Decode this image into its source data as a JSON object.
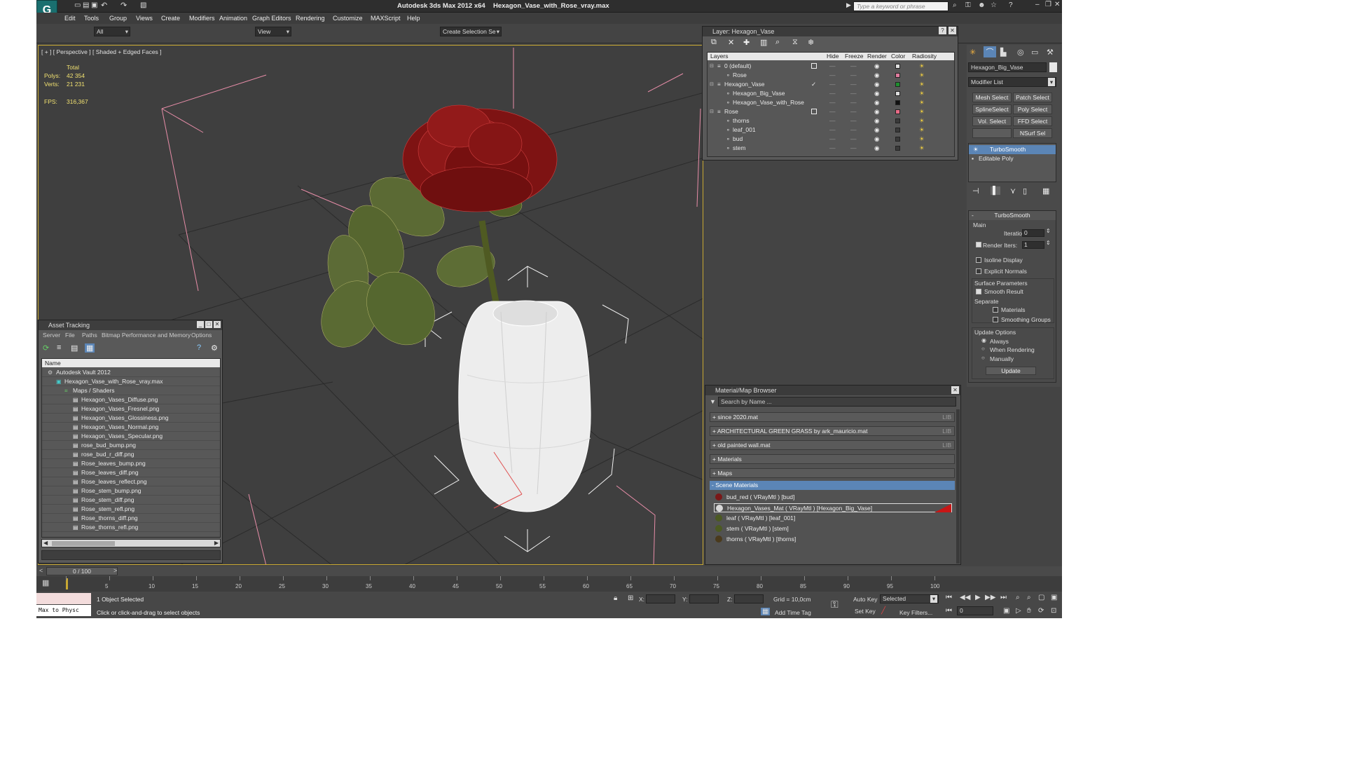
{
  "app": {
    "title_app": "Autodesk 3ds Max 2012 x64",
    "title_file": "Hexagon_Vase_with_Rose_vray.max",
    "search_placeholder": "Type a keyword or phrase"
  },
  "menu": [
    "Edit",
    "Tools",
    "Group",
    "Views",
    "Create",
    "Modifiers",
    "Animation",
    "Graph Editors",
    "Rendering",
    "Customize",
    "MAXScript",
    "Help"
  ],
  "toolbar": {
    "filter_value": "All",
    "view_value": "View",
    "selection_set_value": "Create Selection Se"
  },
  "viewport": {
    "label": "[ + ] [ Perspective ] [ Shaded + Edged Faces ]",
    "stats": {
      "total_label": "Total",
      "polys_label": "Polys:",
      "polys_value": "42 354",
      "verts_label": "Verts:",
      "verts_value": "21 231",
      "fps_label": "FPS:",
      "fps_value": "316,367"
    }
  },
  "layer_panel": {
    "title": "Layer: Hexagon_Vase",
    "columns": [
      "Layers",
      "Hide",
      "Freeze",
      "Render",
      "Color",
      "Radiosity"
    ],
    "rows": [
      {
        "name": "0 (default)",
        "level": 0,
        "color": "#e0e0e0",
        "mark": "square"
      },
      {
        "name": "Rose",
        "level": 1,
        "color": "#e07c9e",
        "mark": ""
      },
      {
        "name": "Hexagon_Vase",
        "level": 0,
        "color": "#1e8f2e",
        "mark": "check"
      },
      {
        "name": "Hexagon_Big_Vase",
        "level": 1,
        "color": "#dedede",
        "mark": ""
      },
      {
        "name": "Hexagon_Vase_with_Rose",
        "level": 1,
        "color": "#111111",
        "mark": ""
      },
      {
        "name": "Rose",
        "level": 0,
        "color": "#e86a86",
        "mark": "square"
      },
      {
        "name": "thorns",
        "level": 1,
        "color": "#3a3a3a",
        "mark": ""
      },
      {
        "name": "leaf_001",
        "level": 1,
        "color": "#3a3a3a",
        "mark": ""
      },
      {
        "name": "bud",
        "level": 1,
        "color": "#3a3a3a",
        "mark": ""
      },
      {
        "name": "stem",
        "level": 1,
        "color": "#3a3a3a",
        "mark": ""
      }
    ]
  },
  "asset_panel": {
    "title": "Asset Tracking",
    "menu": [
      "Server",
      "File",
      "Paths",
      "Bitmap Performance and Memory",
      "Options"
    ],
    "column": "Name",
    "rows": [
      {
        "name": "Autodesk Vault 2012",
        "level": 0
      },
      {
        "name": "Hexagon_Vase_with_Rose_vray.max",
        "level": 1
      },
      {
        "name": "Maps / Shaders",
        "level": 2
      },
      {
        "name": "Hexagon_Vases_Diffuse.png",
        "level": 3
      },
      {
        "name": "Hexagon_Vases_Fresnel.png",
        "level": 3
      },
      {
        "name": "Hexagon_Vases_Glossiness.png",
        "level": 3
      },
      {
        "name": "Hexagon_Vases_Normal.png",
        "level": 3
      },
      {
        "name": "Hexagon_Vases_Specular.png",
        "level": 3
      },
      {
        "name": "rose_bud_bump.png",
        "level": 3
      },
      {
        "name": "rose_bud_r_diff.png",
        "level": 3
      },
      {
        "name": "Rose_leaves_bump.png",
        "level": 3
      },
      {
        "name": "Rose_leaves_diff.png",
        "level": 3
      },
      {
        "name": "Rose_leaves_reflect.png",
        "level": 3
      },
      {
        "name": "Rose_stem_bump.png",
        "level": 3
      },
      {
        "name": "Rose_stem_diff.png",
        "level": 3
      },
      {
        "name": "Rose_stem_refl.png",
        "level": 3
      },
      {
        "name": "Rose_thorns_diff.png",
        "level": 3
      },
      {
        "name": "Rose_thorns_refl.png",
        "level": 3
      }
    ]
  },
  "material_browser": {
    "title": "Material/Map Browser",
    "search_placeholder": "Search by Name ...",
    "groups": [
      {
        "label": "+ since 2020.mat",
        "tag": "LIB"
      },
      {
        "label": "+ ARCHITECTURAL GREEN GRASS by ark_mauricio.mat",
        "tag": "LIB"
      },
      {
        "label": "+ old painted wall.mat",
        "tag": "LIB"
      },
      {
        "label": "+ Materials",
        "tag": ""
      },
      {
        "label": "+ Maps",
        "tag": ""
      }
    ],
    "scene_header": "- Scene Materials",
    "scene_materials": [
      {
        "label": "bud_red  ( VRayMtl ) [bud]",
        "swatch": "#7a1818"
      },
      {
        "label": "Hexagon_Vases_Mat  ( VRayMtl ) [Hexagon_Big_Vase]",
        "swatch": "#d8d8d8"
      },
      {
        "label": "leaf  ( VRayMtl ) [leaf_001]",
        "swatch": "#4c5a22"
      },
      {
        "label": "stem  ( VRayMtl ) [stem]",
        "swatch": "#4c5a22"
      },
      {
        "label": "thorns  ( VRayMtl ) [thorns]",
        "swatch": "#4a3a1c"
      }
    ]
  },
  "command_panel": {
    "object_name": "Hexagon_Big_Vase",
    "modifier_list": "Modifier List",
    "mod_buttons": [
      "Mesh Select",
      "Patch Select",
      "SplineSelect",
      "Poly Select",
      "Vol. Select",
      "FFD Select",
      "",
      "NSurf Sel"
    ],
    "stack": [
      "TurboSmooth",
      "Editable Poly"
    ],
    "rollout_title": "TurboSmooth",
    "main_label": "Main",
    "iterations_label": "Iterations:",
    "iterations_value": "0",
    "render_iters_label": "Render Iters:",
    "render_iters_value": "1",
    "isoline": "Isoline Display",
    "explicit": "Explicit Normals",
    "surface_params": "Surface Parameters",
    "smooth_result": "Smooth Result",
    "separate": "Separate",
    "materials": "Materials",
    "smoothing_groups": "Smoothing Groups",
    "update_options": "Update Options",
    "always": "Always",
    "when_rendering": "When Rendering",
    "manually": "Manually",
    "update": "Update"
  },
  "timeline": {
    "frame_display": "0 / 100",
    "ticks": [
      "0",
      "5",
      "10",
      "15",
      "20",
      "25",
      "30",
      "35",
      "40",
      "45",
      "50",
      "55",
      "60",
      "65",
      "70",
      "75",
      "80",
      "85",
      "90",
      "95",
      "100"
    ]
  },
  "status": {
    "maxscript": "Max to Physc",
    "selected": "1 Object Selected",
    "prompt": "Click or click-and-drag to select objects",
    "x_label": "X:",
    "y_label": "Y:",
    "z_label": "Z:",
    "grid": "Grid = 10,0cm",
    "add_time_tag": "Add Time Tag",
    "auto_key": "Auto Key",
    "set_key": "Set Key",
    "key_mode": "Selected",
    "key_filters": "Key Filters...",
    "frame": "0"
  }
}
